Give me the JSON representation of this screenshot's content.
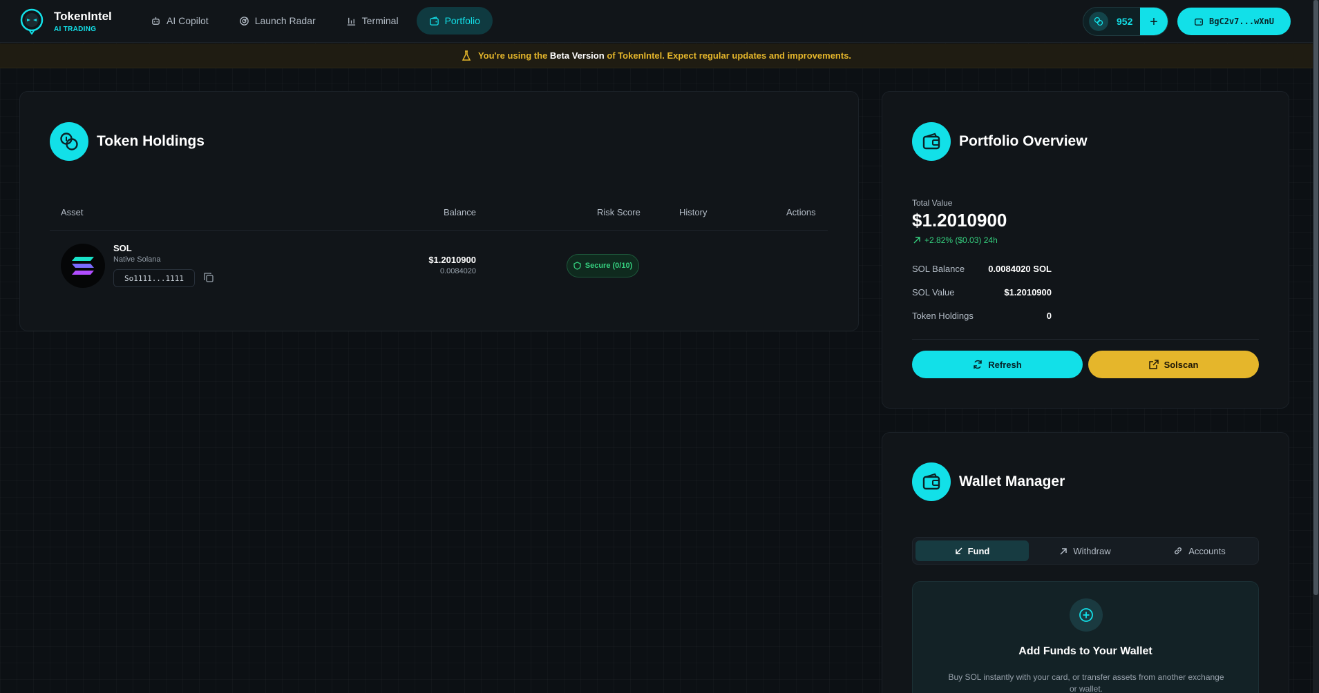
{
  "header": {
    "brand": {
      "name": "TokenIntel",
      "subtitle": "AI TRADING"
    },
    "nav": [
      {
        "label": "AI Copilot",
        "icon": "robot-icon",
        "active": false
      },
      {
        "label": "Launch Radar",
        "icon": "radar-icon",
        "active": false
      },
      {
        "label": "Terminal",
        "icon": "bar-chart-icon",
        "active": false
      },
      {
        "label": "Portfolio",
        "icon": "wallet-icon",
        "active": true
      }
    ],
    "credits": {
      "count": "952",
      "add_label": "+"
    },
    "wallet_address": "BgC2v7...wXnU"
  },
  "banner": {
    "prefix": "You're using the",
    "highlight": "Beta Version",
    "suffix": "of TokenIntel. Expect regular updates and improvements."
  },
  "holdings": {
    "title": "Token Holdings",
    "columns": {
      "asset": "Asset",
      "balance": "Balance",
      "risk": "Risk Score",
      "history": "History",
      "actions": "Actions"
    },
    "rows": [
      {
        "symbol": "SOL",
        "name": "Native Solana",
        "address": "So1111...1111",
        "value": "$1.2010900",
        "amount": "0.0084020",
        "risk": "Secure (0/10)"
      }
    ]
  },
  "overview": {
    "title": "Portfolio Overview",
    "total_label": "Total Value",
    "total_value": "$1.2010900",
    "change": "+2.82% ($0.03) 24h",
    "rows": [
      {
        "label": "SOL Balance",
        "value": "0.0084020 SOL"
      },
      {
        "label": "SOL Value",
        "value": "$1.2010900"
      },
      {
        "label": "Token Holdings",
        "value": "0"
      }
    ],
    "refresh_label": "Refresh",
    "solscan_label": "Solscan"
  },
  "wallet_manager": {
    "title": "Wallet Manager",
    "tabs": [
      {
        "label": "Fund",
        "active": true
      },
      {
        "label": "Withdraw",
        "active": false
      },
      {
        "label": "Accounts",
        "active": false
      }
    ],
    "fund": {
      "title": "Add Funds to Your Wallet",
      "description": "Buy SOL instantly with your card, or transfer assets from another exchange or wallet."
    }
  },
  "colors": {
    "accent": "#12e0e8",
    "warning": "#e5b62b",
    "success": "#35d07f",
    "background": "#0c1014"
  }
}
